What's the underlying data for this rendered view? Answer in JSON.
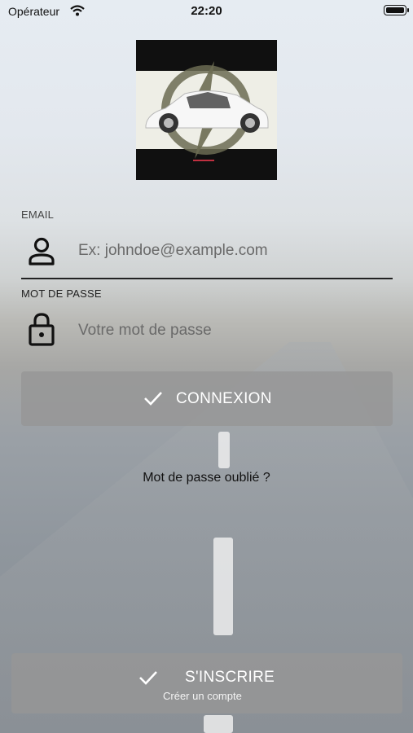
{
  "status_bar": {
    "carrier": "Opérateur",
    "time": "22:20"
  },
  "email": {
    "label": "EMAIL",
    "placeholder": "Ex: johndoe@example.com"
  },
  "password": {
    "label": "MOT DE PASSE",
    "placeholder": "Votre mot de passe"
  },
  "login_button": {
    "label": "CONNEXION"
  },
  "forgot_link": "Mot de passe oublié ?",
  "signup_button": {
    "label": "S'INSCRIRE",
    "sublabel": "Créer un compte"
  },
  "colors": {
    "button_bg": "#969696",
    "logo_bg": "#101010",
    "logo_band": "#eeeee6",
    "bolt": "#6b6b52"
  }
}
